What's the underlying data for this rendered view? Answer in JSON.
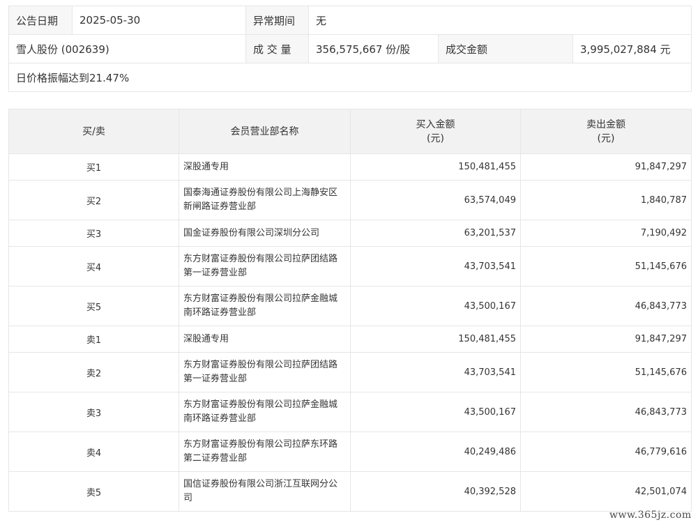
{
  "info": {
    "date_label": "公告日期",
    "date_value": "2025-05-30",
    "abnormal_label": "异常期间",
    "abnormal_value": "无",
    "stock": "雪人股份 (002639)",
    "volume_label": "成 交 量",
    "volume_value": "356,575,667 份/股",
    "amount_label": "成交金额",
    "amount_value": "3,995,027,884 元",
    "reason": "日价格振幅达到21.47%"
  },
  "table": {
    "headers": {
      "side": "买/卖",
      "name": "会员营业部名称",
      "buy_line1": "买入金额",
      "buy_line2": "(元)",
      "sell_line1": "卖出金额",
      "sell_line2": "(元)"
    },
    "rows": [
      {
        "side": "买1",
        "name": "深股通专用",
        "buy": "150,481,455",
        "sell": "91,847,297"
      },
      {
        "side": "买2",
        "name": "国泰海通证券股份有限公司上海静安区新闸路证券营业部",
        "buy": "63,574,049",
        "sell": "1,840,787"
      },
      {
        "side": "买3",
        "name": "国金证券股份有限公司深圳分公司",
        "buy": "63,201,537",
        "sell": "7,190,492"
      },
      {
        "side": "买4",
        "name": "东方财富证券股份有限公司拉萨团结路第一证券营业部",
        "buy": "43,703,541",
        "sell": "51,145,676"
      },
      {
        "side": "买5",
        "name": "东方财富证券股份有限公司拉萨金融城南环路证券营业部",
        "buy": "43,500,167",
        "sell": "46,843,773"
      },
      {
        "side": "卖1",
        "name": "深股通专用",
        "buy": "150,481,455",
        "sell": "91,847,297"
      },
      {
        "side": "卖2",
        "name": "东方财富证券股份有限公司拉萨团结路第一证券营业部",
        "buy": "43,703,541",
        "sell": "51,145,676"
      },
      {
        "side": "卖3",
        "name": "东方财富证券股份有限公司拉萨金融城南环路证券营业部",
        "buy": "43,500,167",
        "sell": "46,843,773"
      },
      {
        "side": "卖4",
        "name": "东方财富证券股份有限公司拉萨东环路第二证券营业部",
        "buy": "40,249,486",
        "sell": "46,779,616"
      },
      {
        "side": "卖5",
        "name": "国信证券股份有限公司浙江互联网分公司",
        "buy": "40,392,528",
        "sell": "42,501,074"
      }
    ]
  },
  "watermark": "www.365jz.com"
}
